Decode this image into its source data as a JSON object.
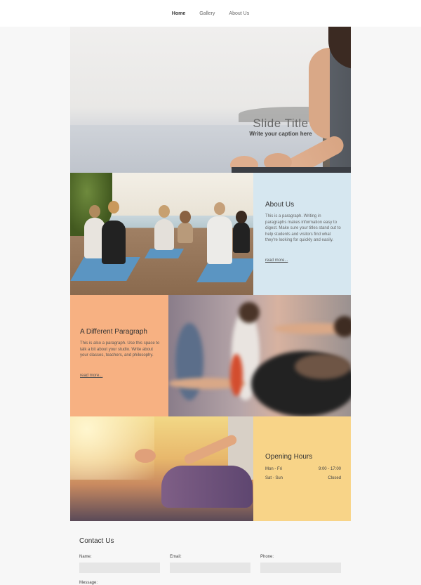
{
  "nav": {
    "items": [
      {
        "label": "Home",
        "active": true
      },
      {
        "label": "Gallery",
        "active": false
      },
      {
        "label": "About Us",
        "active": false
      }
    ]
  },
  "hero": {
    "title": "Slide Title",
    "caption": "Write your caption here"
  },
  "about": {
    "heading": "About Us",
    "paragraph": "This is a paragraph. Writing in paragraphs makes information easy to digest. Make sure your titles stand out to help students and visitors find what they're looking for quickly and easily.",
    "link": "read more..."
  },
  "different": {
    "heading": "A Different Paragraph",
    "paragraph": "This is also a paragraph. Use this space to talk a bit about your studio. Write about your classes, teachers, and philosophy.",
    "link": "read more..."
  },
  "hours": {
    "heading": "Opening Hours",
    "rows": [
      {
        "day": "Mon - Fri",
        "time": "9:00 - 17:00"
      },
      {
        "day": "Sat - Sun",
        "time": "Closed"
      }
    ]
  },
  "contact": {
    "heading": "Contact Us",
    "name_label": "Name:",
    "email_label": "Email:",
    "phone_label": "Phone:",
    "message_label": "Message:"
  },
  "colors": {
    "about_bg": "#d6e7f0",
    "different_bg": "#f7b182",
    "hours_bg": "#f8d488",
    "page_bg": "#f7f7f7"
  }
}
